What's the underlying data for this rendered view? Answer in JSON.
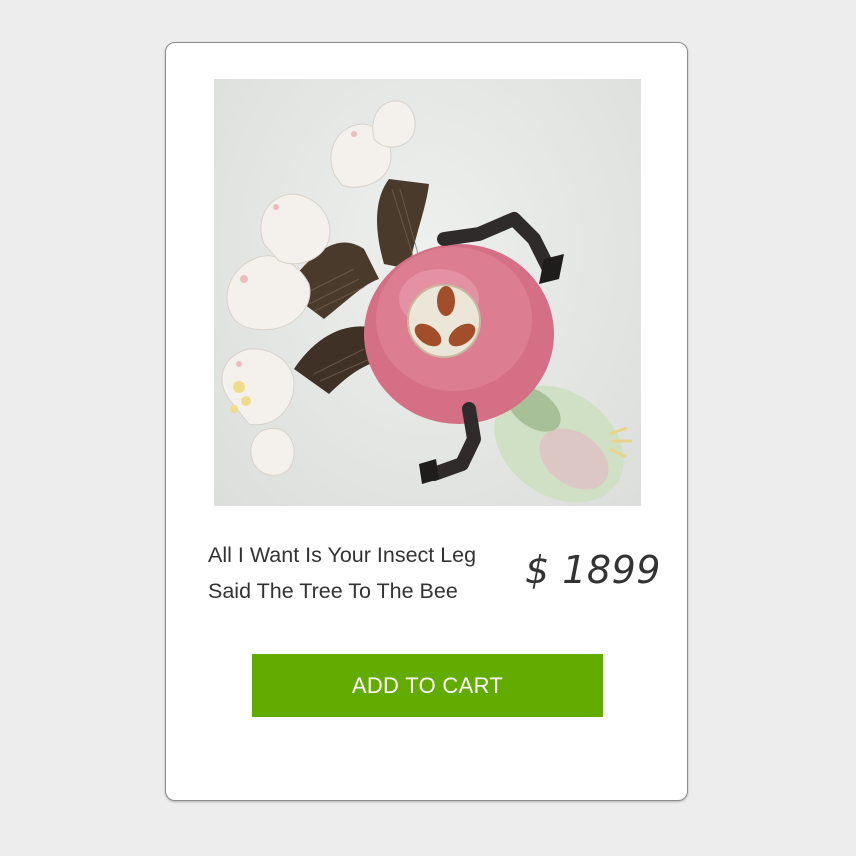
{
  "product": {
    "image_alt": "",
    "title_line1": "All I Want Is Your Insect Leg",
    "title_line2": "Said The Tree To The Bee",
    "price": "$ 1899"
  },
  "actions": {
    "add_to_cart_label": "ADD TO CART"
  },
  "colors": {
    "page_background": "#ededed",
    "card_background": "#ffffff",
    "button_background": "#62ab00",
    "button_text": "#ffffff",
    "text": "#333333"
  }
}
